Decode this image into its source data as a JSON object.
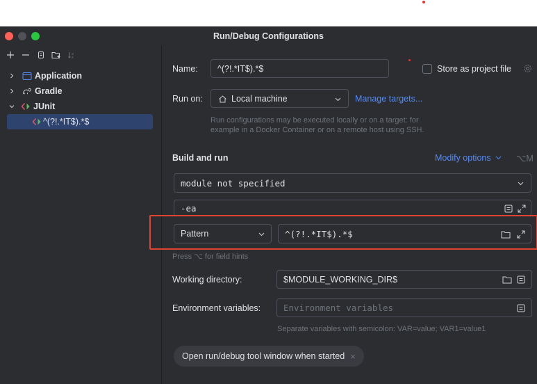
{
  "window": {
    "title": "Run/Debug Configurations"
  },
  "colors": {
    "red": "#ff5f57",
    "yellow": "#febc2e",
    "green": "#28c840",
    "accent": "#548af7",
    "highlight": "#e0432f",
    "selection": "#2e436e"
  },
  "toolbar": {
    "icons": [
      "add-icon",
      "remove-icon",
      "copy-icon",
      "new-folder-icon",
      "sort-icon"
    ]
  },
  "tree": {
    "application": "Application",
    "gradle": "Gradle",
    "junit": "JUnit",
    "selected": "^(?!.*IT$).*$"
  },
  "form": {
    "name_label": "Name:",
    "name_value": "^(?!.*IT$).*$",
    "store_label": "Store as project file",
    "run_on_label": "Run on:",
    "run_on_value": "Local machine",
    "manage_targets": "Manage targets...",
    "run_hint_1": "Run configurations may be executed locally or on a target: for",
    "run_hint_2": "example in a Docker Container or on a remote host using SSH.",
    "build_and_run": "Build and run",
    "modify_options": "Modify options",
    "modify_shortcut": "⌥M",
    "module_value": "module not specified",
    "vm_options": "-ea",
    "pattern_kind": "Pattern",
    "pattern_value": "^(?!.*IT$).*$",
    "field_hint": "Press ⌥ for field hints",
    "workdir_label": "Working directory:",
    "workdir_value": "$MODULE_WORKING_DIR$",
    "env_label": "Environment variables:",
    "env_placeholder": "Environment variables",
    "env_hint": "Separate variables with semicolon: VAR=value; VAR1=value1",
    "open_tool_window": "Open run/debug tool window when started",
    "close_glyph": "×"
  }
}
